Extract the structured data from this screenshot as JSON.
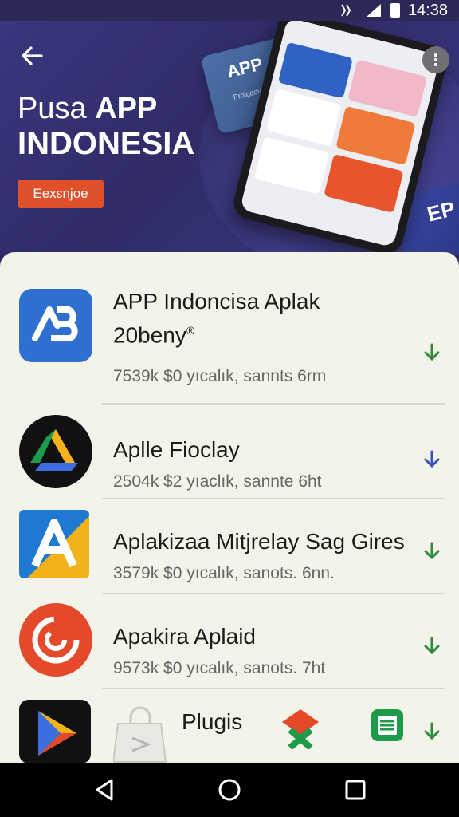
{
  "status_bar": {
    "time": "14:38"
  },
  "hero": {
    "title_prefix": "Pusa",
    "title_bold": "APP",
    "title_line2": "INDONESIA",
    "button_label": "Eexɛnjoe",
    "float_card_label": "APP",
    "float_card_small": "Proigaou",
    "ep_card_label": "EP"
  },
  "apps": [
    {
      "name_line1": "APP Indoncisa Aplak",
      "name_line2": "20beny",
      "reg_mark": "®",
      "meta": "7539k   $0 yıcalık,  sannts  6rm",
      "download_color": "#2e8b3e"
    },
    {
      "name": "Aplle Fioclay",
      "meta": "2504k   $2 yıaclık,  sannte  6ht",
      "download_color": "#3553b8"
    },
    {
      "name": "Aplakizaa Mitjrelay Sag Gires",
      "meta": "3579k   $0 yıcalık,  sanots.  6nn.",
      "download_color": "#2e8b3e"
    },
    {
      "name": "Apakira Aplaid",
      "meta": "9573k   $0 yıcalık,  sanots.  7ht",
      "download_color": "#2e8b3e"
    },
    {
      "name": "Plugis",
      "download_color": "#2e8b3e"
    }
  ],
  "colors": {
    "accent": "#e0502b",
    "hero_bg": "#322f6e",
    "sheet_bg": "#f3f3ea"
  }
}
